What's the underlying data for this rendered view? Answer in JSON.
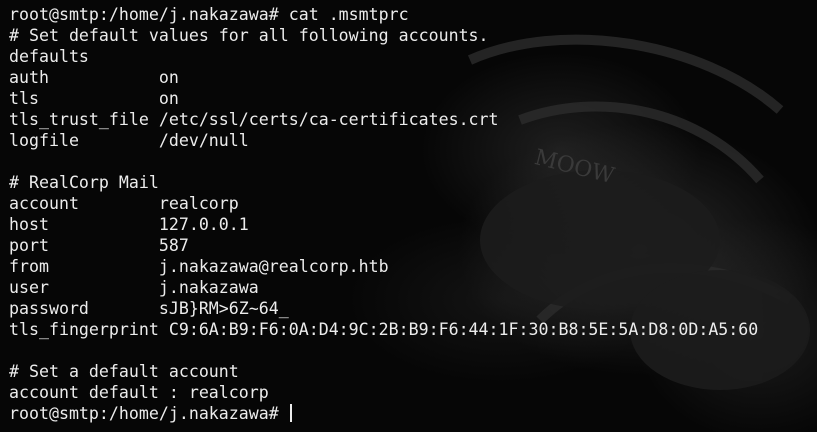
{
  "terminal": {
    "lines": [
      "root@smtp:/home/j.nakazawa# cat .msmtprc",
      "# Set default values for all following accounts.",
      "defaults",
      "auth           on",
      "tls            on",
      "tls_trust_file /etc/ssl/certs/ca-certificates.crt",
      "logfile        /dev/null",
      "",
      "# RealCorp Mail",
      "account        realcorp",
      "host           127.0.0.1",
      "port           587",
      "from           j.nakazawa@realcorp.htb",
      "user           j.nakazawa",
      "password       sJB}RM>6Z~64_",
      "tls_fingerprint C9:6A:B9:F6:0A:D4:9C:2B:B9:F6:44:1F:30:B8:5E:5A:D8:0D:A5:60",
      "",
      "# Set a default account",
      "account default : realcorp"
    ],
    "prompt": "root@smtp:/home/j.nakazawa# "
  },
  "wallpaper": {
    "watermark_text": "MOOW"
  },
  "colors": {
    "text": "#ececec",
    "background": "#060606"
  }
}
